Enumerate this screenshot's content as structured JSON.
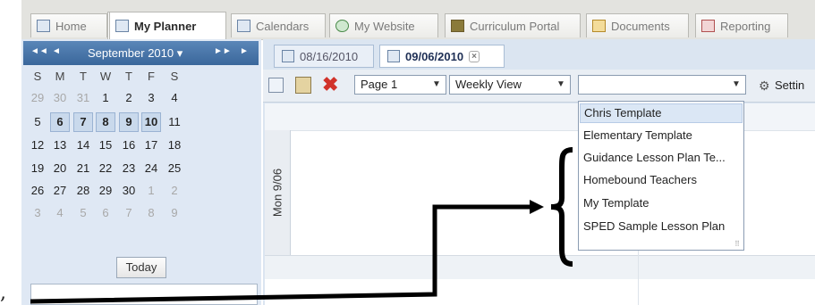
{
  "tabs": [
    {
      "label": "Home"
    },
    {
      "label": "My Planner"
    },
    {
      "label": "Calendars"
    },
    {
      "label": "My Website"
    },
    {
      "label": "Curriculum Portal"
    },
    {
      "label": "Documents"
    },
    {
      "label": "Reporting"
    }
  ],
  "calendar": {
    "prev_year": "◄◄",
    "prev": "◄",
    "month": "September 2010 ▾",
    "next": "►",
    "next_year": "►►",
    "days_of_week": [
      "S",
      "M",
      "T",
      "W",
      "T",
      "F",
      "S"
    ],
    "weeks": [
      [
        "29",
        "30",
        "31",
        "1",
        "2",
        "3",
        "4"
      ],
      [
        "5",
        "6",
        "7",
        "8",
        "9",
        "10",
        "11"
      ],
      [
        "12",
        "13",
        "14",
        "15",
        "16",
        "17",
        "18"
      ],
      [
        "19",
        "20",
        "21",
        "22",
        "23",
        "24",
        "25"
      ],
      [
        "26",
        "27",
        "28",
        "29",
        "30",
        "1",
        "2"
      ],
      [
        "3",
        "4",
        "5",
        "6",
        "7",
        "8",
        "9"
      ]
    ],
    "today_label": "Today"
  },
  "date_tabs": [
    {
      "label": "08/16/2010"
    },
    {
      "label": "09/06/2010",
      "close": "×"
    }
  ],
  "toolbar": {
    "page_select": "Page 1",
    "view_select": "Weekly View",
    "template_select": "",
    "settings_label": "Settin"
  },
  "planner": {
    "day_label": "Mon 9/06"
  },
  "template_dropdown": {
    "items": [
      "Chris Template",
      "Elementary Template",
      "Guidance Lesson Plan Te...",
      "Homebound Teachers",
      "My Template",
      "SPED Sample Lesson Plan"
    ]
  },
  "stray_mark": ","
}
